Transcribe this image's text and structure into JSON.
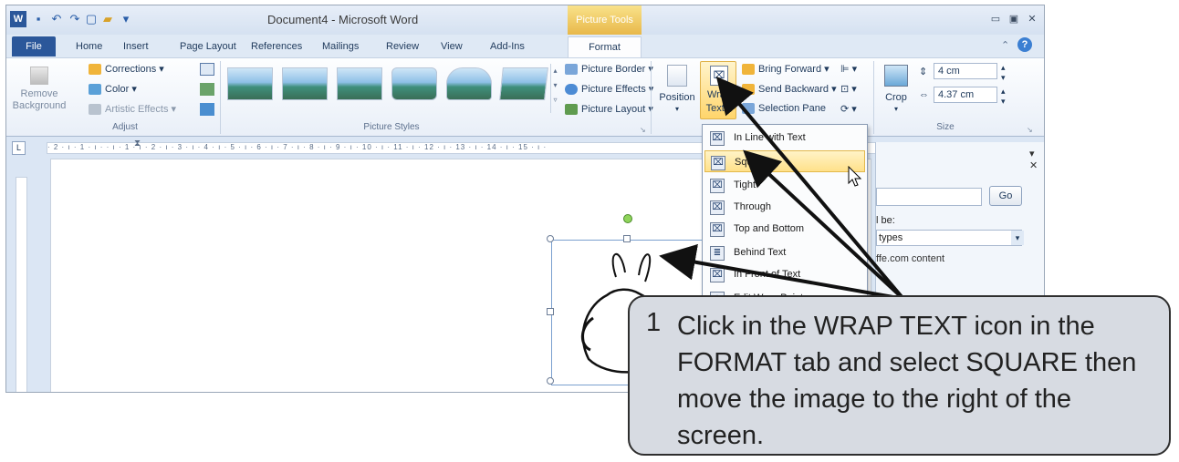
{
  "window": {
    "title": "Document4  -  Microsoft Word",
    "context_tab": "Picture Tools",
    "min": "▭",
    "max": "▣",
    "close": "✕"
  },
  "tabs": [
    "File",
    "Home",
    "Insert",
    "Page Layout",
    "References",
    "Mailings",
    "Review",
    "View",
    "Add-Ins",
    "Format"
  ],
  "ribbon": {
    "remove_bg_line1": "Remove",
    "remove_bg_line2": "Background",
    "corrections": "Corrections ▾",
    "color": "Color ▾",
    "artistic": "Artistic Effects ▾",
    "adjust_label": "Adjust",
    "picture_styles_label": "Picture Styles",
    "picture_border": "Picture Border ▾",
    "picture_effects": "Picture Effects ▾",
    "picture_layout": "Picture Layout ▾",
    "position": "Position",
    "wrap_line1": "Wrap",
    "wrap_line2": "Text ▾",
    "bring_forward": "Bring Forward ▾",
    "send_backward": "Send Backward ▾",
    "selection_pane": "Selection Pane",
    "crop": "Crop",
    "height": "4 cm",
    "width": "4.37 cm",
    "size_label": "Size"
  },
  "ruler": "· 2 · ı · 1 · ı ·   · ı · 1 · ı · 2 · ı · 3 · ı · 4 · ı · 5 · ı · 6 · ı · 7 · ı · 8 · ı · 9 · ı · 10 · ı · 11 · ı · 12 · ı · 13 · ı · 14 · ı · 15 · ı ·",
  "wrap_menu": [
    {
      "label": "In Line with Text"
    },
    {
      "label": "Square"
    },
    {
      "label": "Tight"
    },
    {
      "label": "Through"
    },
    {
      "label": "Top and Bottom"
    },
    {
      "label": "Behind Text"
    },
    {
      "label": "In Front of Text"
    },
    {
      "label": "Edit Wrap Points"
    }
  ],
  "pane": {
    "go_button": "Go",
    "label": "l be:",
    "select_value": "types",
    "link": "ffe.com content"
  },
  "callout": {
    "number": "1",
    "text": "Click in the WRAP TEXT icon in the FORMAT tab and select SQUARE then move the image to the right of the screen."
  },
  "colors": {
    "file_tab": "#2b579a",
    "picture_tools": "#e8b84a",
    "highlight": "#ffe18a"
  }
}
